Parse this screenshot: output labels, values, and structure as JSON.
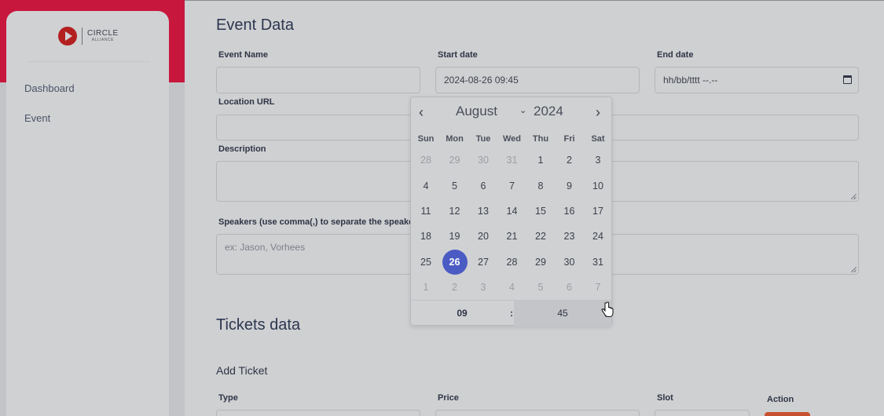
{
  "sidebar": {
    "logo_line1": "CIRCLE",
    "logo_line2": "ALLIANCE",
    "items": [
      {
        "label": "Dashboard"
      },
      {
        "label": "Event"
      }
    ]
  },
  "event_section": {
    "title": "Event Data",
    "event_name_label": "Event Name",
    "event_name_value": "",
    "start_date_label": "Start date",
    "start_date_value": "2024-08-26 09:45",
    "end_date_label": "End date",
    "end_date_placeholder": "hh/bb/tttt --.--",
    "location_label": "Location URL",
    "description_label": "Description",
    "speakers_label": "Speakers (use comma(,) to separate the speaker n",
    "speakers_placeholder": "ex: Jason, Vorhees"
  },
  "datepicker": {
    "month": "August",
    "year": "2024",
    "weekdays": [
      "Sun",
      "Mon",
      "Tue",
      "Wed",
      "Thu",
      "Fri",
      "Sat"
    ],
    "weeks": [
      [
        "28",
        "29",
        "30",
        "31",
        "1",
        "2",
        "3"
      ],
      [
        "4",
        "5",
        "6",
        "7",
        "8",
        "9",
        "10"
      ],
      [
        "11",
        "12",
        "13",
        "14",
        "15",
        "16",
        "17"
      ],
      [
        "18",
        "19",
        "20",
        "21",
        "22",
        "23",
        "24"
      ],
      [
        "25",
        "26",
        "27",
        "28",
        "29",
        "30",
        "31"
      ],
      [
        "1",
        "2",
        "3",
        "4",
        "5",
        "6",
        "7"
      ]
    ],
    "selected_day": "26",
    "hour": "09",
    "minute": "45",
    "separator": ":"
  },
  "tickets_section": {
    "title": "Tickets data",
    "add_ticket": "Add Ticket",
    "columns": [
      "Type",
      "Price",
      "Slot",
      "Action"
    ]
  },
  "colors": {
    "brand_red": "#c8173d",
    "selected_day": "#4b5bc4",
    "action_button": "#c8512f"
  }
}
